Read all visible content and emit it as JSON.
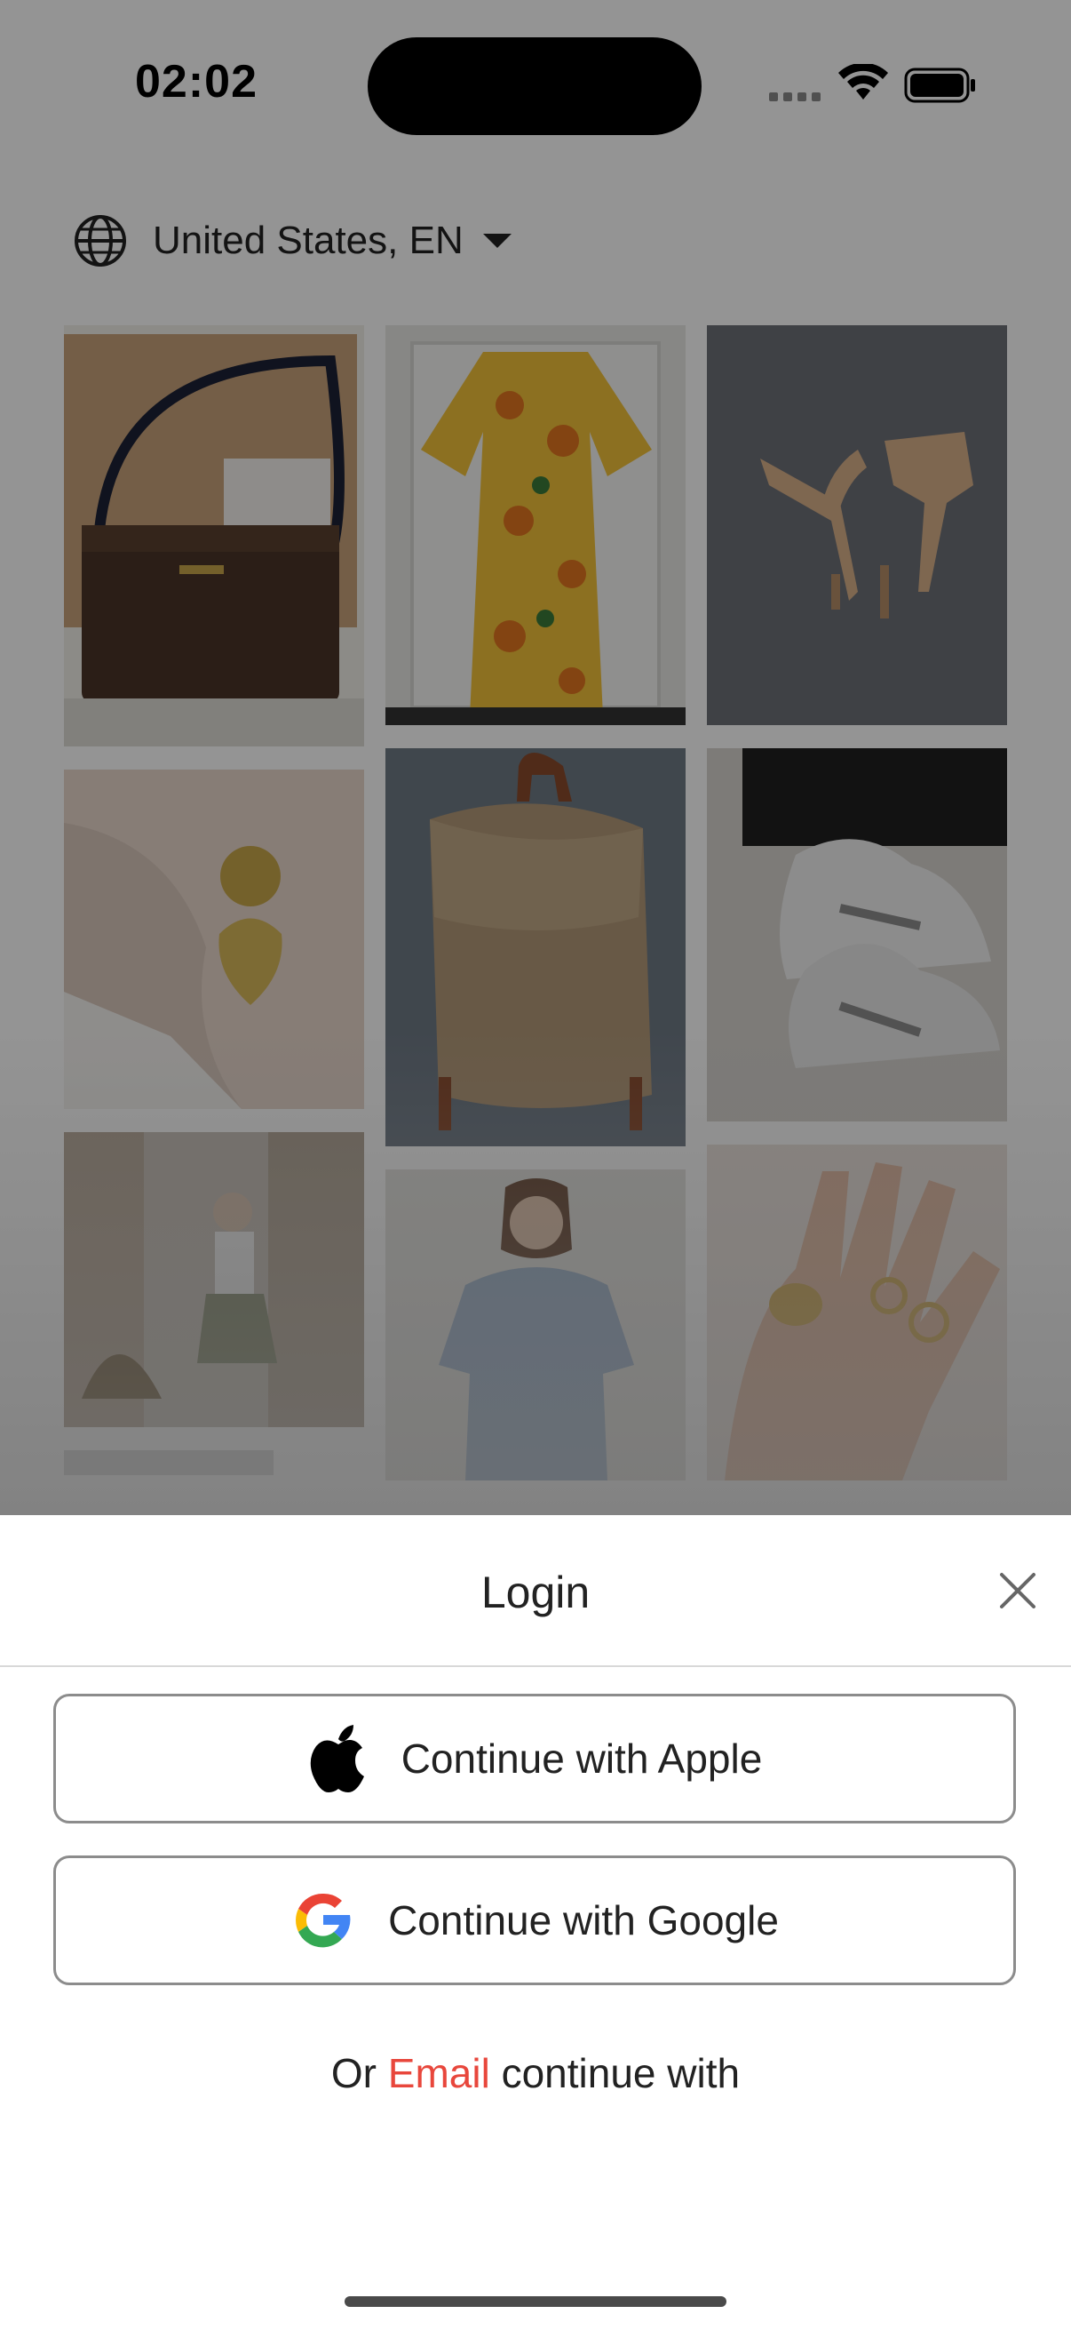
{
  "status_bar": {
    "time": "02:02"
  },
  "region_selector": {
    "label": "United States, EN",
    "icon": "globe-icon"
  },
  "feed": {
    "items": [
      {
        "name": "handbag-photo",
        "icon": "photo"
      },
      {
        "name": "floral-dress-photo",
        "icon": "photo"
      },
      {
        "name": "heels-photo",
        "icon": "photo"
      },
      {
        "name": "earring-photo",
        "icon": "photo"
      },
      {
        "name": "crochet-bag-photo",
        "icon": "photo"
      },
      {
        "name": "sneakers-photo",
        "icon": "photo"
      },
      {
        "name": "outfit-photo",
        "icon": "photo"
      },
      {
        "name": "blue-dress-photo",
        "icon": "photo"
      },
      {
        "name": "rings-photo",
        "icon": "photo"
      }
    ]
  },
  "login_sheet": {
    "title": "Login",
    "apple_button": "Continue with Apple",
    "google_button": "Continue with Google",
    "or_prefix": "Or",
    "email_link": "Email",
    "or_suffix": "continue with",
    "accent_color": "#e8473c"
  }
}
